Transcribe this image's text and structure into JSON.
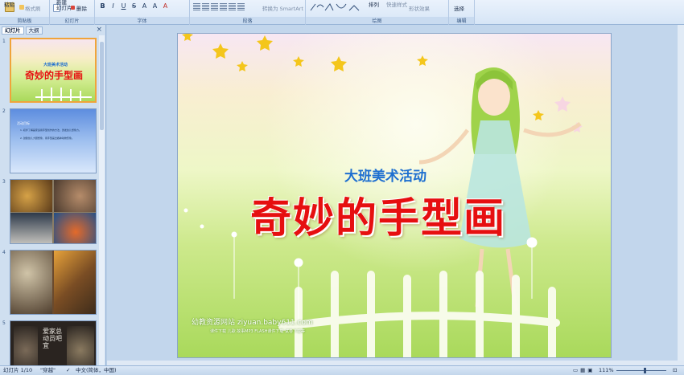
{
  "ribbon": {
    "paste": "粘贴",
    "format_painter": "格式刷",
    "new_slide": "新建\n幻灯片",
    "delete": "删除",
    "groups": [
      "剪贴板",
      "幻灯片",
      "字体",
      "段落",
      "绘图",
      "编辑"
    ],
    "convert_smartart": "转换为 SmartArt",
    "arrange": "排列",
    "quick_styles": "快速样式",
    "shape_effects": "形状效果",
    "select": "选择"
  },
  "sidebar": {
    "tabs": [
      "幻灯片",
      "大纲"
    ],
    "slide_numbers": [
      "1",
      "2",
      "3",
      "4",
      "5"
    ]
  },
  "thumb1": {
    "subtitle": "大班美术活动",
    "title": "奇妙的手型画"
  },
  "thumb2": {
    "heading": "活动目标",
    "line1": "1. 初步了解画家运用手型创作的方法，激发幼儿想象力。",
    "line2": "2. 鼓励幼儿大胆想象，用手型画出各种动物形象。"
  },
  "thumb5": {
    "caption": "爱家总动员吧宜"
  },
  "slide": {
    "subtitle": "大班美术活动",
    "title": "奇妙的手型画",
    "footer_main": "幼教资源网站  ziyuan.baby611.com",
    "footer_links": "课件下载   儿歌   故事MP3   FLASH课件下载   试卷下载等"
  },
  "status": {
    "slide_counter": "幻灯片 1/10",
    "theme": "\"穿越\"",
    "language": "中文(简体，中国)",
    "zoom": "111%"
  },
  "colors": {
    "title_red": "#e60f10",
    "subtitle_blue": "#1e6fd0",
    "selection_orange": "#f0a43a"
  }
}
